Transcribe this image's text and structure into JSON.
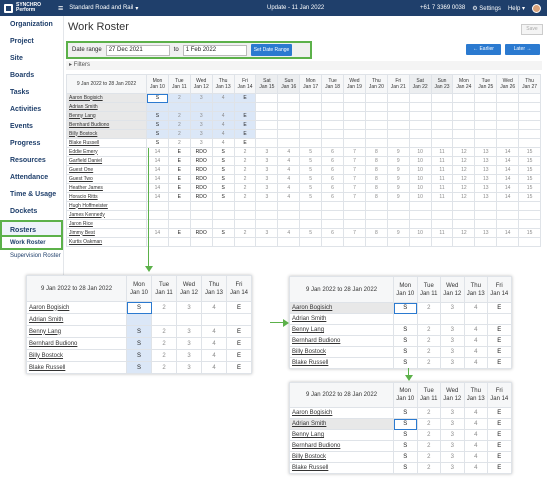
{
  "topbar": {
    "logo_line1": "SYNCHRO",
    "logo_line2": "Perform",
    "org_name": "Standard Road and Rail",
    "update_text": "Update - 11 Jan 2022",
    "phone": "+61 7 3369 0038",
    "settings_label": "Settings",
    "help_label": "Help"
  },
  "sidebar": {
    "items": [
      "Organization",
      "Project",
      "Site",
      "Boards",
      "Tasks",
      "Activities",
      "Events",
      "Progress",
      "Resources",
      "Attendance",
      "Time & Usage",
      "Dockets"
    ],
    "rosters_label": "Rosters",
    "sub_items": [
      "Work Roster",
      "Supervision Roster"
    ]
  },
  "page": {
    "title": "Work Roster",
    "save_label": "Save",
    "date_range_label": "Date range",
    "date_from": "27 Dec 2021",
    "to_label": "to",
    "date_to": "1 Feb 2022",
    "set_range_label": "Set Date Range",
    "earlier_label": "← Earlier",
    "later_label": "Later →",
    "filters_label": "▸ Filters"
  },
  "roster": {
    "range_label": "9 Jan 2022 to 28 Jan 2022",
    "days": [
      {
        "d": "Mon",
        "dt": "Jan 10"
      },
      {
        "d": "Tue",
        "dt": "Jan 11"
      },
      {
        "d": "Wed",
        "dt": "Jan 12"
      },
      {
        "d": "Thu",
        "dt": "Jan 13"
      },
      {
        "d": "Fri",
        "dt": "Jan 14"
      },
      {
        "d": "Sat",
        "dt": "Jan 15"
      },
      {
        "d": "Sun",
        "dt": "Jan 16"
      },
      {
        "d": "Mon",
        "dt": "Jan 17"
      },
      {
        "d": "Tue",
        "dt": "Jan 18"
      },
      {
        "d": "Wed",
        "dt": "Jan 19"
      },
      {
        "d": "Thu",
        "dt": "Jan 20"
      },
      {
        "d": "Fri",
        "dt": "Jan 21"
      },
      {
        "d": "Sat",
        "dt": "Jan 22"
      },
      {
        "d": "Sun",
        "dt": "Jan 23"
      },
      {
        "d": "Mon",
        "dt": "Jan 24"
      },
      {
        "d": "Tue",
        "dt": "Jan 25"
      },
      {
        "d": "Wed",
        "dt": "Jan 26"
      },
      {
        "d": "Thu",
        "dt": "Jan 27"
      }
    ],
    "rows": [
      {
        "name": "Aaron Bogisich",
        "cells": [
          "S",
          "2",
          "3",
          "4",
          "E",
          "",
          "",
          "",
          "",
          "",
          "",
          "",
          "",
          "",
          "",
          "",
          "",
          ""
        ]
      },
      {
        "name": "Adrian Smith",
        "cells": [
          "",
          "",
          "",
          "",
          "",
          "",
          "",
          "",
          "",
          "",
          "",
          "",
          "",
          "",
          "",
          "",
          "",
          ""
        ]
      },
      {
        "name": "Benny Lang",
        "cells": [
          "S",
          "2",
          "3",
          "4",
          "E",
          "",
          "",
          "",
          "",
          "",
          "",
          "",
          "",
          "",
          "",
          "",
          "",
          ""
        ]
      },
      {
        "name": "Bernhard Budiono",
        "cells": [
          "S",
          "2",
          "3",
          "4",
          "E",
          "",
          "",
          "",
          "",
          "",
          "",
          "",
          "",
          "",
          "",
          "",
          "",
          ""
        ]
      },
      {
        "name": "Billy Bostock",
        "cells": [
          "S",
          "2",
          "3",
          "4",
          "E",
          "",
          "",
          "",
          "",
          "",
          "",
          "",
          "",
          "",
          "",
          "",
          "",
          ""
        ]
      },
      {
        "name": "Blake Russell",
        "cells": [
          "S",
          "2",
          "3",
          "4",
          "E",
          "",
          "",
          "",
          "",
          "",
          "",
          "",
          "",
          "",
          "",
          "",
          "",
          ""
        ]
      },
      {
        "name": "Eddie Emery",
        "cells": [
          "14",
          "E",
          "RDO",
          "S",
          "2",
          "3",
          "4",
          "5",
          "6",
          "7",
          "8",
          "9",
          "10",
          "11",
          "12",
          "13",
          "14",
          "15"
        ]
      },
      {
        "name": "Garfield Daniel",
        "cells": [
          "14",
          "E",
          "RDO",
          "S",
          "2",
          "3",
          "4",
          "5",
          "6",
          "7",
          "8",
          "9",
          "10",
          "11",
          "12",
          "13",
          "14",
          "15"
        ]
      },
      {
        "name": "Guest One",
        "cells": [
          "14",
          "E",
          "RDO",
          "S",
          "2",
          "3",
          "4",
          "5",
          "6",
          "7",
          "8",
          "9",
          "10",
          "11",
          "12",
          "13",
          "14",
          "15"
        ]
      },
      {
        "name": "Guest Two",
        "cells": [
          "14",
          "E",
          "RDO",
          "S",
          "2",
          "3",
          "4",
          "5",
          "6",
          "7",
          "8",
          "9",
          "10",
          "11",
          "12",
          "13",
          "14",
          "15"
        ]
      },
      {
        "name": "Heather James",
        "cells": [
          "14",
          "E",
          "RDO",
          "S",
          "2",
          "3",
          "4",
          "5",
          "6",
          "7",
          "8",
          "9",
          "10",
          "11",
          "12",
          "13",
          "14",
          "15"
        ]
      },
      {
        "name": "Horacio Ritts",
        "cells": [
          "14",
          "E",
          "RDO",
          "S",
          "2",
          "3",
          "4",
          "5",
          "6",
          "7",
          "8",
          "9",
          "10",
          "11",
          "12",
          "13",
          "14",
          "15"
        ]
      },
      {
        "name": "Hugh Hoffmeister",
        "cells": [
          "",
          "",
          "",
          "",
          "",
          "",
          "",
          "",
          "",
          "",
          "",
          "",
          "",
          "",
          "",
          "",
          "",
          ""
        ]
      },
      {
        "name": "James Kennedy",
        "cells": [
          "",
          "",
          "",
          "",
          "",
          "",
          "",
          "",
          "",
          "",
          "",
          "",
          "",
          "",
          "",
          "",
          "",
          ""
        ]
      },
      {
        "name": "Jaron Rice",
        "cells": [
          "",
          "",
          "",
          "",
          "",
          "",
          "",
          "",
          "",
          "",
          "",
          "",
          "",
          "",
          "",
          "",
          "",
          ""
        ]
      },
      {
        "name": "Jimmy Best",
        "cells": [
          "14",
          "E",
          "RDO",
          "S",
          "2",
          "3",
          "4",
          "5",
          "6",
          "7",
          "8",
          "9",
          "10",
          "11",
          "12",
          "13",
          "14",
          "15"
        ]
      },
      {
        "name": "Kurtis Oakman",
        "cells": [
          "",
          "",
          "",
          "",
          "",
          "",
          "",
          "",
          "",
          "",
          "",
          "",
          "",
          "",
          "",
          "",
          "",
          ""
        ]
      }
    ]
  },
  "zoom_rows": {
    "z1": [
      {
        "name": "Aaron Bogisich",
        "cells": [
          "S",
          "2",
          "3",
          "4",
          "E"
        ]
      },
      {
        "name": "Adrian Smith",
        "cells": [
          "",
          "",
          "",
          "",
          ""
        ]
      },
      {
        "name": "Benny Lang",
        "cells": [
          "S",
          "2",
          "3",
          "4",
          "E"
        ]
      },
      {
        "name": "Bernhard Budiono",
        "cells": [
          "S",
          "2",
          "3",
          "4",
          "E"
        ]
      },
      {
        "name": "Billy Bostock",
        "cells": [
          "S",
          "2",
          "3",
          "4",
          "E"
        ]
      },
      {
        "name": "Blake Russell",
        "cells": [
          "S",
          "2",
          "3",
          "4",
          "E"
        ]
      }
    ],
    "z2": [
      {
        "name": "Aaron Bogisich",
        "cells": [
          "S",
          "2",
          "3",
          "4",
          "E"
        ]
      },
      {
        "name": "Adrian Smith",
        "cells": [
          "",
          "",
          "",
          "",
          ""
        ]
      },
      {
        "name": "Benny Lang",
        "cells": [
          "S",
          "2",
          "3",
          "4",
          "E"
        ]
      },
      {
        "name": "Bernhard Budiono",
        "cells": [
          "S",
          "2",
          "3",
          "4",
          "E"
        ]
      },
      {
        "name": "Billy Bostock",
        "cells": [
          "S",
          "2",
          "3",
          "4",
          "E"
        ]
      },
      {
        "name": "Blake Russell",
        "cells": [
          "S",
          "2",
          "3",
          "4",
          "E"
        ]
      }
    ],
    "z3": [
      {
        "name": "Aaron Bogisich",
        "cells": [
          "S",
          "2",
          "3",
          "4",
          "E"
        ]
      },
      {
        "name": "Adrian Smith",
        "cells": [
          "S",
          "2",
          "3",
          "4",
          "E"
        ]
      },
      {
        "name": "Benny Lang",
        "cells": [
          "S",
          "2",
          "3",
          "4",
          "E"
        ]
      },
      {
        "name": "Bernhard Budiono",
        "cells": [
          "S",
          "2",
          "3",
          "4",
          "E"
        ]
      },
      {
        "name": "Billy Bostock",
        "cells": [
          "S",
          "2",
          "3",
          "4",
          "E"
        ]
      },
      {
        "name": "Blake Russell",
        "cells": [
          "S",
          "2",
          "3",
          "4",
          "E"
        ]
      }
    ]
  },
  "colors": {
    "topbar": "#1f3f6b",
    "accent": "#2b7ad0",
    "highlight_border": "#5cb14a",
    "selection_fill": "#dbe7f7"
  }
}
